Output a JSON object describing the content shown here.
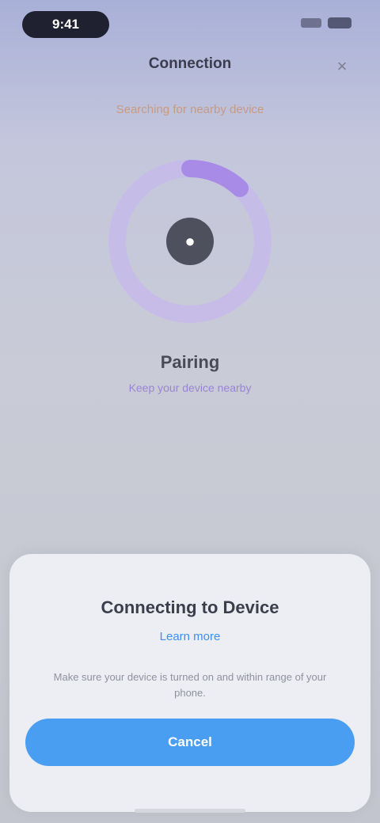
{
  "status_bar": {
    "time": "9:41",
    "signal_icon": "signal-icon",
    "battery_icon": "battery-icon"
  },
  "nav": {
    "title": "Connection",
    "close_icon": "close-icon",
    "close_glyph": "×"
  },
  "subtitle": "Searching for nearby device",
  "ring": {
    "progress": 0.12,
    "center_icon": "device-icon",
    "center_glyph": "●",
    "status": "Pairing",
    "hint": "Keep your device nearby",
    "colors": {
      "track": "#c6b6ee",
      "arc": "#a78be6",
      "center": "#4f505e"
    }
  },
  "sheet": {
    "title": "Connecting to Device",
    "link": "Learn more",
    "description": "Make sure your device is turned on and within range of your phone.",
    "button_label": "Cancel"
  },
  "colors": {
    "accent": "#4a9ef2",
    "link": "#3d8ef0"
  }
}
